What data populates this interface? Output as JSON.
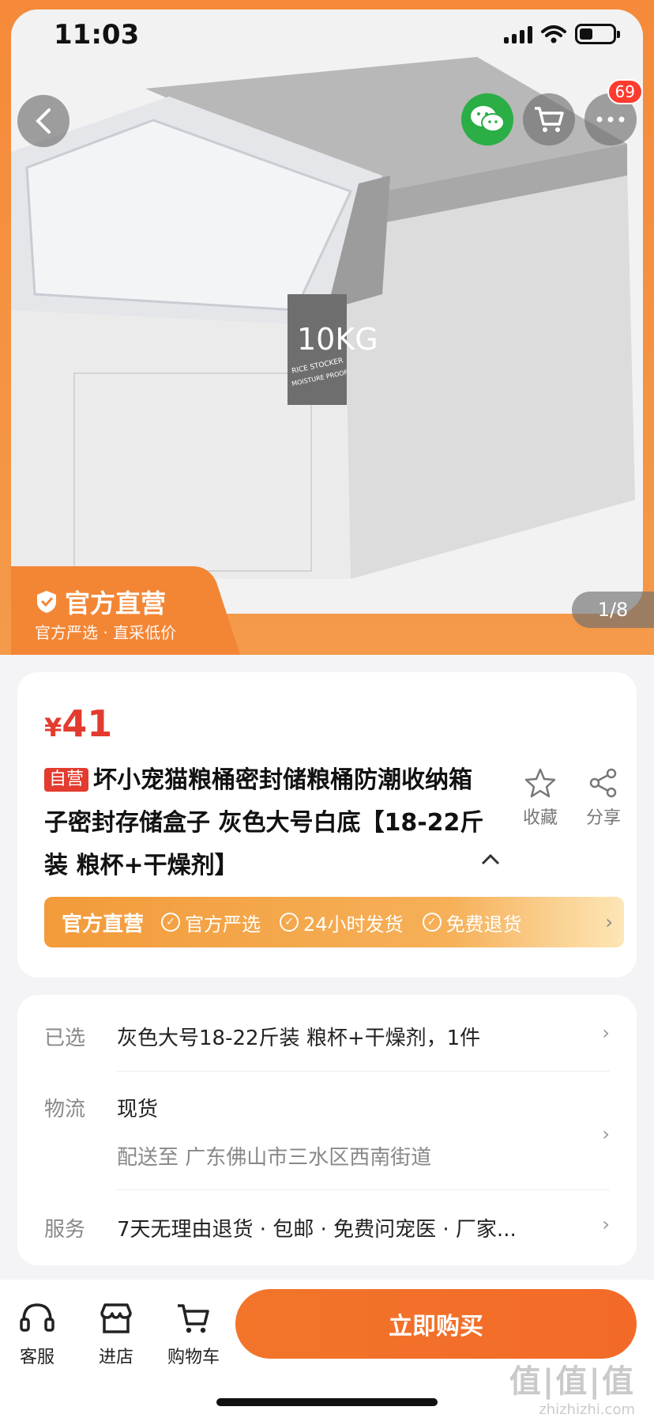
{
  "status_bar": {
    "time": "11:03"
  },
  "header": {
    "cart_badge": "69"
  },
  "gallery": {
    "page_counter": "1/8",
    "image_text_size": "10KG",
    "image_text_line1": "RICE STOCKER",
    "image_text_line2": "MOISTURE PROOF"
  },
  "official_badge": {
    "title": "官方直营",
    "subtitle": "官方严选 · 直采低价"
  },
  "product": {
    "currency": "¥",
    "price": "41",
    "self_tag": "自营",
    "title": "坏小宠猫粮桶密封储粮桶防潮收纳箱子密封存储盒子 灰色大号白底【18-22斤装 粮杯+干燥剂】",
    "favorite_label": "收藏",
    "share_label": "分享"
  },
  "promo": {
    "main": "官方直营",
    "items": [
      "官方严选",
      "24小时发货",
      "免费退货"
    ]
  },
  "details": {
    "selected": {
      "label": "已选",
      "value": "灰色大号18-22斤装 粮杯+干燥剂，1件"
    },
    "logistics": {
      "label": "物流",
      "value": "现货",
      "sub": "配送至 广东佛山市三水区西南街道"
    },
    "service": {
      "label": "服务",
      "value": "7天无理由退货 · 包邮 · 免费问宠医 · 厂家..."
    }
  },
  "bottom_nav": {
    "customer_service": "客服",
    "store": "进店",
    "cart": "购物车",
    "buy_now": "立即购买"
  },
  "watermark": {
    "brand": "值|值|值",
    "domain": "zhizhizhi.com"
  },
  "colors": {
    "accent": "#f36a28",
    "price": "#e33b2f",
    "wechat": "#2aae45"
  }
}
